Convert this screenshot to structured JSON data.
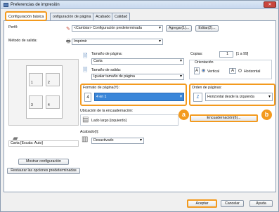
{
  "window": {
    "title": "Preferencias de impresión"
  },
  "tabs": [
    {
      "label": "Configuración básica"
    },
    {
      "label": "onfiguración de página"
    },
    {
      "label": "Acabado"
    },
    {
      "label": "Calidad"
    }
  ],
  "profile": {
    "label": "Perfil:",
    "value": "<Cambiar> Configuración predeterminada",
    "add_button": "Agregar(1)...",
    "edit_button": "Editar(2)..."
  },
  "output_method": {
    "label": "Método de salida:",
    "value": "Imprimir"
  },
  "preview": {
    "pages": [
      "1",
      "2",
      "3",
      "4"
    ],
    "caption": "Carta [Escala: Auto]"
  },
  "page_size": {
    "label": "Tamaño de página:",
    "value": "Carta"
  },
  "output_size": {
    "label": "Tamaño de salida:",
    "value": "Igualar tamaño de página"
  },
  "copies": {
    "label": "Copias:",
    "value": "1",
    "range": "[1 a 99]"
  },
  "orientation": {
    "label": "Orientación",
    "vertical": "Vertical",
    "horizontal": "Horizontal",
    "vertical_icon": "A",
    "horizontal_icon": "A"
  },
  "page_layout": {
    "label": "Formato de página(Y):",
    "value": "4 en 1",
    "icon": "4"
  },
  "page_order": {
    "label": "Orden de páginas:",
    "value": "Horizontal desde la izquierda"
  },
  "binding_location": {
    "label": "Ubicación de la encuadernación:",
    "value": "Lado largo [izquierdo]"
  },
  "binding_button": "Encuadernación(6)...",
  "finishing": {
    "label": "Acabado(I):",
    "value": "Desactivado"
  },
  "left_buttons": {
    "show_settings": "Mostrar configuración",
    "restore_defaults": "Restaurar las opciones predeterminadas"
  },
  "badges": {
    "a": "a",
    "b": "b"
  },
  "footer": {
    "ok": "Aceptar",
    "cancel": "Cancelar",
    "help": "Ayuda"
  },
  "colors": {
    "highlight": "#f39a1e",
    "selection": "#3a86d9"
  }
}
